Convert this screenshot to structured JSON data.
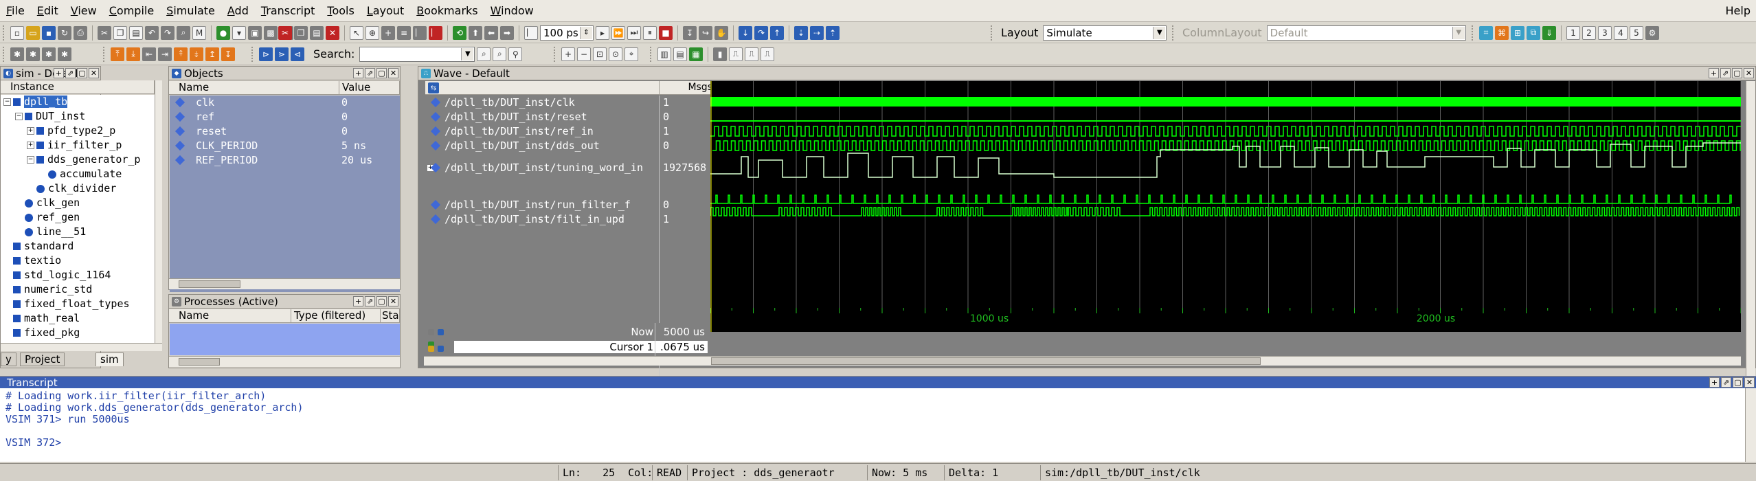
{
  "menu": [
    "File",
    "Edit",
    "View",
    "Compile",
    "Simulate",
    "Add",
    "Transcript",
    "Tools",
    "Layout",
    "Bookmarks",
    "Window"
  ],
  "help": "Help",
  "toolbar": {
    "run_length": "100 ps",
    "layout_label": "Layout",
    "layout_value": "Simulate",
    "column_layout_label": "ColumnLayout",
    "column_layout_value": "Default",
    "search_label": "Search:",
    "search_value": ""
  },
  "instance_pane": {
    "title": "sim - Default",
    "column": "Instance",
    "tabs": [
      "y",
      "Project",
      "sim"
    ],
    "rows": [
      {
        "label": "dpll_tb",
        "exp": "−",
        "icon": "square",
        "selected": true
      },
      {
        "label": "DUT_inst",
        "exp": "−",
        "icon": "square"
      },
      {
        "label": "pfd_type2_p",
        "exp": "+",
        "icon": "square"
      },
      {
        "label": "iir_filter_p",
        "exp": "+",
        "icon": "square"
      },
      {
        "label": "dds_generator_p",
        "exp": "−",
        "icon": "square"
      },
      {
        "label": "accumulate",
        "exp": "",
        "icon": "dot"
      },
      {
        "label": "clk_divider",
        "exp": "",
        "icon": "dot"
      },
      {
        "label": "clk_gen",
        "exp": "",
        "icon": "dot"
      },
      {
        "label": "ref_gen",
        "exp": "",
        "icon": "dot"
      },
      {
        "label": "line__51",
        "exp": "",
        "icon": "dot"
      },
      {
        "label": "standard",
        "exp": "",
        "icon": "square"
      },
      {
        "label": "textio",
        "exp": "",
        "icon": "square"
      },
      {
        "label": "std_logic_1164",
        "exp": "",
        "icon": "square"
      },
      {
        "label": "numeric_std",
        "exp": "",
        "icon": "square"
      },
      {
        "label": "fixed_float_types",
        "exp": "",
        "icon": "square"
      },
      {
        "label": "math_real",
        "exp": "",
        "icon": "square"
      },
      {
        "label": "fixed_pkg",
        "exp": "",
        "icon": "square"
      }
    ]
  },
  "objects_pane": {
    "title": "Objects",
    "col_name": "Name",
    "col_value": "Value",
    "rows": [
      {
        "name": "clk",
        "value": "0"
      },
      {
        "name": "ref",
        "value": "0"
      },
      {
        "name": "reset",
        "value": "0"
      },
      {
        "name": "CLK_PERIOD",
        "value": "5 ns"
      },
      {
        "name": "REF_PERIOD",
        "value": "20 us"
      }
    ]
  },
  "processes_pane": {
    "title": "Processes (Active)",
    "col_name": "Name",
    "col_type": "Type (filtered)",
    "col_state": "State"
  },
  "wave_pane": {
    "title": "Wave - Default",
    "msgs": "Msgs",
    "signals": [
      {
        "name": "/dpll_tb/DUT_inst/clk",
        "value": "1"
      },
      {
        "name": "/dpll_tb/DUT_inst/reset",
        "value": "0"
      },
      {
        "name": "/dpll_tb/DUT_inst/ref_in",
        "value": "1"
      },
      {
        "name": "/dpll_tb/DUT_inst/dds_out",
        "value": "0"
      },
      {
        "name": "/dpll_tb/DUT_inst/tuning_word_in",
        "value": "1927568"
      },
      {
        "name": "/dpll_tb/DUT_inst/run_filter_f",
        "value": "0"
      },
      {
        "name": "/dpll_tb/DUT_inst/filt_in_upd",
        "value": "1"
      }
    ],
    "now_label": "Now",
    "now_value": "5000 us",
    "cursor_label": "Cursor 1",
    "cursor_value": ".0675 us",
    "time_ticks": [
      "1000 us",
      "2000 us"
    ],
    "colors": {
      "signal": "#00ff00",
      "grid": "#606060",
      "background": "#000000"
    }
  },
  "transcript": {
    "title": "Transcript",
    "lines": [
      "# Loading work.iir_filter(iir_filter_arch)",
      "# Loading work.dds_generator(dds_generator_arch)",
      "VSIM 371> run 5000us",
      "",
      "VSIM 372>"
    ]
  },
  "status": {
    "ln_label": "Ln:",
    "ln_value": "25",
    "col_label": "Col:",
    "mode": "READ",
    "project": "Project : dds_generaotr",
    "now": "Now: 5 ms",
    "delta": "Delta: 1",
    "context": "sim:/dpll_tb/DUT_inst/clk"
  }
}
